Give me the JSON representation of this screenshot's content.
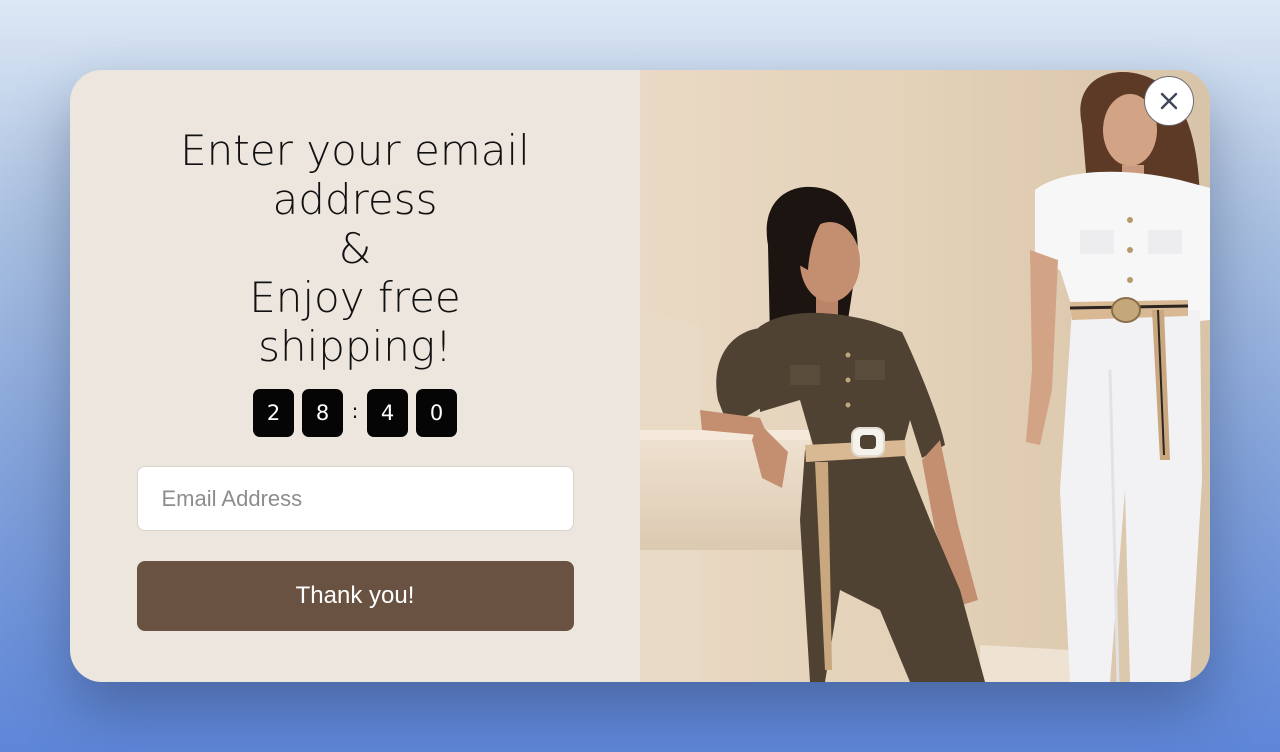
{
  "popup": {
    "headline_lines": [
      "Enter your email",
      "address",
      "&",
      "Enjoy free",
      "shipping!"
    ],
    "timer": {
      "digits": [
        "2",
        "8",
        "4",
        "0"
      ],
      "separator": ":"
    },
    "email": {
      "placeholder": "Email Address",
      "value": ""
    },
    "submit_label": "Thank you!",
    "close_icon": "close-icon",
    "image": "two-models-in-jumpsuits-photo"
  },
  "colors": {
    "panel_background": "#ede6df",
    "button_background": "#6a5242",
    "timer_digit_background": "#050505"
  }
}
